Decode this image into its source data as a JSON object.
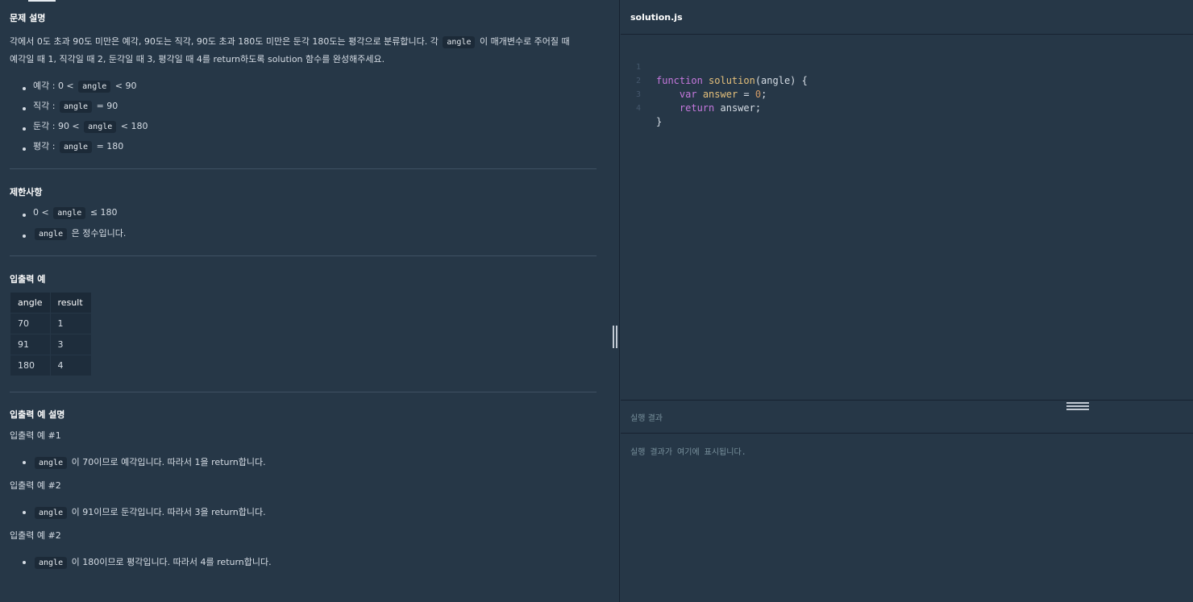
{
  "problem": {
    "title": "문제 설명",
    "desc_part1": "각에서 0도 초과 90도 미만은 예각, 90도는 직각, 90도 초과 180도 미만은 둔각 180도는 평각으로 분류합니다. 각",
    "desc_code": "angle",
    "desc_part2": "이 매개변수로 주어질 때",
    "desc_line2": "예각일 때 1, 직각일 때 2, 둔각일 때 3, 평각일 때 4를 return하도록 solution 함수를 완성해주세요.",
    "bullets": [
      {
        "prefix": "예각 : 0 <",
        "code": "angle",
        "suffix": "< 90"
      },
      {
        "prefix": "직각 :",
        "code": "angle",
        "suffix": "= 90"
      },
      {
        "prefix": "둔각 : 90 <",
        "code": "angle",
        "suffix": "< 180"
      },
      {
        "prefix": "평각 :",
        "code": "angle",
        "suffix": "= 180"
      }
    ]
  },
  "constraints": {
    "title": "제한사항",
    "items": [
      {
        "prefix": "0 <",
        "code": "angle",
        "suffix": "≤ 180"
      },
      {
        "prefix": "",
        "code": "angle",
        "suffix": "은 정수입니다."
      }
    ]
  },
  "examples": {
    "title": "입출력 예",
    "headers": [
      "angle",
      "result"
    ],
    "rows": [
      [
        "70",
        "1"
      ],
      [
        "91",
        "3"
      ],
      [
        "180",
        "4"
      ]
    ]
  },
  "explanation": {
    "title": "입출력 예 설명",
    "items": [
      {
        "heading": "입출력 예 #1",
        "code": "angle",
        "text": "이 70이므로 예각입니다. 따라서 1을 return합니다."
      },
      {
        "heading": "입출력 예 #2",
        "code": "angle",
        "text": "이 91이므로 둔각입니다. 따라서 3을 return합니다."
      },
      {
        "heading": "입출력 예 #2",
        "code": "angle",
        "text": "이 180이므로 평각입니다. 따라서 4를 return합니다."
      }
    ]
  },
  "editor": {
    "filename": "solution.js",
    "line_numbers": [
      "1",
      "2",
      "3",
      "4"
    ],
    "line1": {
      "kw": "function",
      "fn": "solution",
      "rest": "(angle) {"
    },
    "line2": {
      "kw": "var",
      "var": "answer",
      "eq": " = ",
      "num": "0",
      "end": ";"
    },
    "line3": {
      "kw": "return",
      "rest": " answer;"
    },
    "line4": {
      "rest": "}"
    }
  },
  "result": {
    "title": "실행 결과",
    "placeholder": "실행 결과가 여기에 표시됩니다."
  },
  "colors": {
    "background": "#263747",
    "code_bg": "#1c2a38",
    "keyword": "#c678dd",
    "function_name": "#e5c07b",
    "number": "#d19a66"
  }
}
